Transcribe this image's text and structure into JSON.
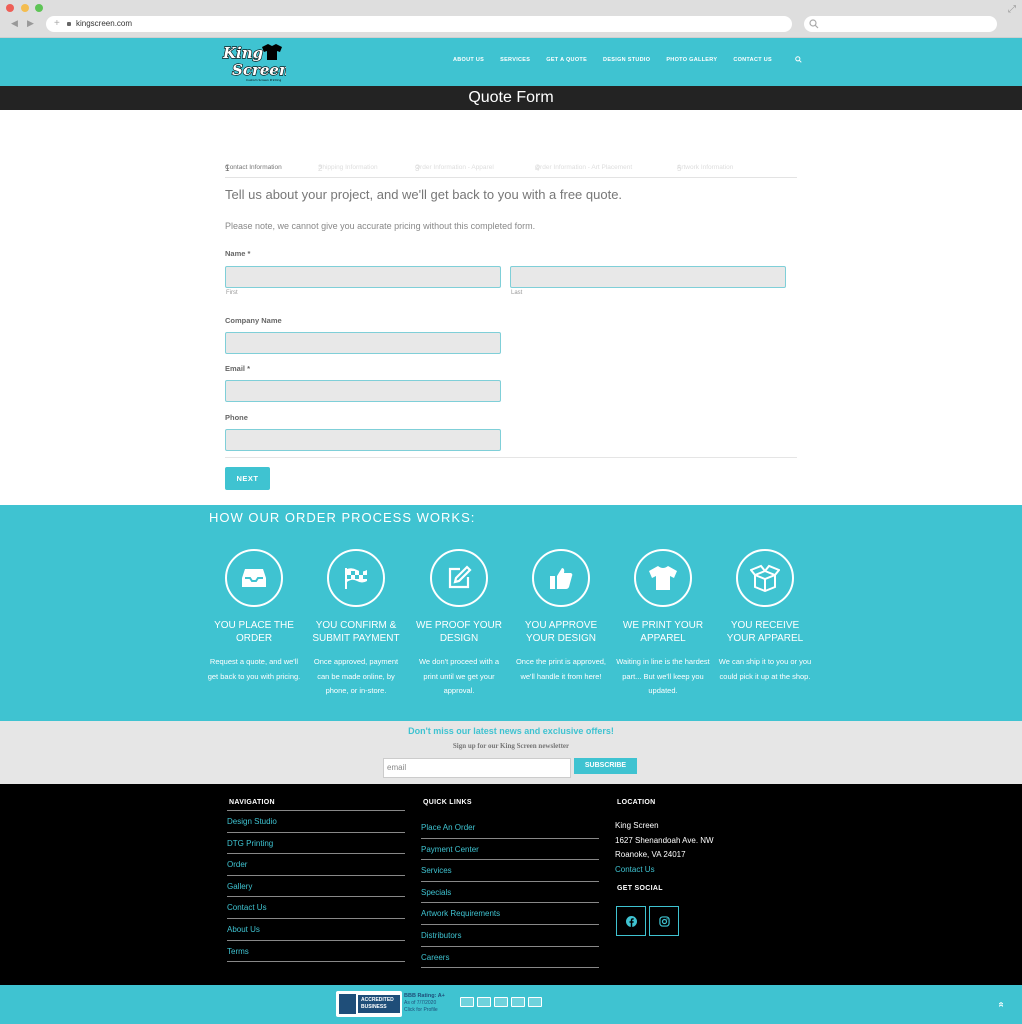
{
  "browser": {
    "url": "kingscreen.com",
    "back": "◀",
    "forward": "▶",
    "new_tab": "+"
  },
  "header": {
    "logo_text": [
      "King",
      "Screen"
    ],
    "logo_tagline": "Custom Screen Printing",
    "nav": [
      "ABOUT US",
      "SERVICES",
      "GET A QUOTE",
      "DESIGN STUDIO",
      "PHOTO GALLERY",
      "CONTACT US"
    ]
  },
  "page_title": "Quote Form",
  "form": {
    "steps": [
      {
        "num": "1",
        "label": "Contact Information"
      },
      {
        "num": "2",
        "label": "Shipping Information"
      },
      {
        "num": "3",
        "label": "Order Information - Apparel"
      },
      {
        "num": "4",
        "label": "Order Information - Art Placement"
      },
      {
        "num": "5",
        "label": "Artwork Information"
      }
    ],
    "lead": "Tell us about your project, and we'll get back to you with a free quote.",
    "note": "Please note, we cannot give you accurate pricing without this completed form.",
    "name_label": "Name *",
    "first_sub": "First",
    "last_sub": "Last",
    "company_label": "Company Name",
    "email_label": "Email *",
    "phone_label": "Phone",
    "next_label": "NEXT"
  },
  "process": {
    "title": "HOW OUR ORDER PROCESS WORKS:",
    "steps": [
      {
        "icon": "inbox-icon",
        "title": "YOU PLACE THE ORDER",
        "text": "Request a quote, and we'll get back to you with pricing."
      },
      {
        "icon": "checkered-flag-icon",
        "title": "YOU CONFIRM & SUBMIT PAYMENT",
        "text": "Once approved, payment can be made online, by phone, or in-store."
      },
      {
        "icon": "edit-icon",
        "title": "WE PROOF YOUR DESIGN",
        "text": "We don't proceed with a print until we get your approval."
      },
      {
        "icon": "thumbs-up-icon",
        "title": "YOU APPROVE YOUR DESIGN",
        "text": "Once the print is approved, we'll handle it from here!"
      },
      {
        "icon": "tshirt-icon",
        "title": "WE PRINT YOUR APPAREL",
        "text": "Waiting in line is the hardest part... But we'll keep you updated."
      },
      {
        "icon": "box-open-icon",
        "title": "YOU RECEIVE YOUR APPAREL",
        "text": "We can ship it to you or you could pick it up at the shop."
      }
    ]
  },
  "newsletter": {
    "heading": "Don't miss our latest news and exclusive offers!",
    "subheading": "Sign up for our King Screen newsletter",
    "placeholder": "email",
    "button": "SUBSCRIBE"
  },
  "footer": {
    "nav_heading": "NAVIGATION",
    "nav_items": [
      "Design Studio",
      "DTG Printing",
      "Order",
      "Gallery",
      "Contact Us",
      "About Us",
      "Terms"
    ],
    "quick_heading": "QUICK LINKS",
    "quick_items": [
      "Place An Order",
      "Payment Center",
      "Services",
      "Specials",
      "Artwork Requirements",
      "Distributors",
      "Careers"
    ],
    "location_heading": "LOCATION",
    "location_lines": [
      "King Screen",
      "1627 Shenandoah Ave. NW",
      "Roanoke, VA 24017"
    ],
    "location_link": "Contact Us",
    "social_heading": "GET SOCIAL",
    "social": [
      "facebook-icon",
      "instagram-icon"
    ]
  },
  "bottom": {
    "bbb_badge": "ACCREDITED BUSINESS",
    "bbb_rating": "BBB Rating: A+",
    "bbb_asof": "As of 7/7/2020",
    "bbb_click": "Click for Profile",
    "payment_icons": [
      "visa-icon",
      "mastercard-icon",
      "amex-icon",
      "discover-icon",
      "paypal-icon"
    ],
    "to_top": "»"
  },
  "colors": {
    "brand": "#3fc3d1",
    "dark": "#232323",
    "footer": "#000000"
  }
}
